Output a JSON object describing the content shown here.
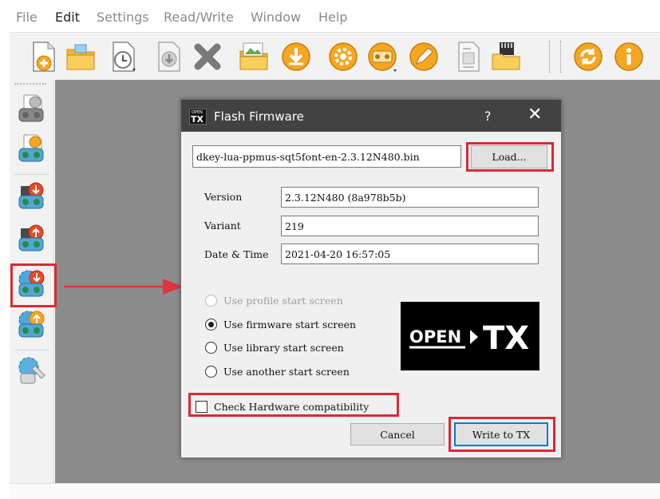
{
  "menu": {
    "items": [
      "File",
      "Edit",
      "Settings",
      "Read/Write",
      "Window",
      "Help"
    ]
  },
  "toolbar": {
    "icons": [
      "new-file-icon",
      "open-folder-icon",
      "recent-files-icon",
      "save-icon",
      "delete-icon",
      "image-folder-icon",
      "download-icon",
      "settings-gear-icon",
      "radio-settings-icon",
      "edit-tool-icon",
      "document-icon",
      "sd-card-icon",
      "update-icon",
      "info-icon"
    ]
  },
  "sidebar": {
    "icons": [
      "read-models-icon",
      "write-models-icon",
      "read-firmware-icon",
      "write-backup-icon",
      "flash-firmware-icon",
      "write-firmware-icon",
      "compare-icon"
    ]
  },
  "colors": {
    "highlight": "#d92b35",
    "title_bar": "#424242",
    "workspace": "#8c8c8c",
    "accent_border": "#0a78d7"
  },
  "dialog": {
    "title": "Flash Firmware",
    "help": "?",
    "close": "✕",
    "file_path": "dkey-lua-ppmus-sqt5font-en-2.3.12N480.bin",
    "load_label": "Load...",
    "version_label": "Version",
    "version_value": "2.3.12N480 (8a978b5b)",
    "variant_label": "Variant",
    "variant_value": "219",
    "datetime_label": "Date & Time",
    "datetime_value": "2021-04-20 16:57:05",
    "radio_options": [
      {
        "label": "Use profile start screen",
        "checked": false,
        "disabled": true
      },
      {
        "label": "Use firmware start screen",
        "checked": true,
        "disabled": false
      },
      {
        "label": "Use library start screen",
        "checked": false,
        "disabled": false
      },
      {
        "label": "Use another start screen",
        "checked": false,
        "disabled": false
      }
    ],
    "check_hardware_label": "Check Hardware compatibility",
    "check_hardware_checked": false,
    "cancel_label": "Cancel",
    "write_label": "Write to TX"
  }
}
